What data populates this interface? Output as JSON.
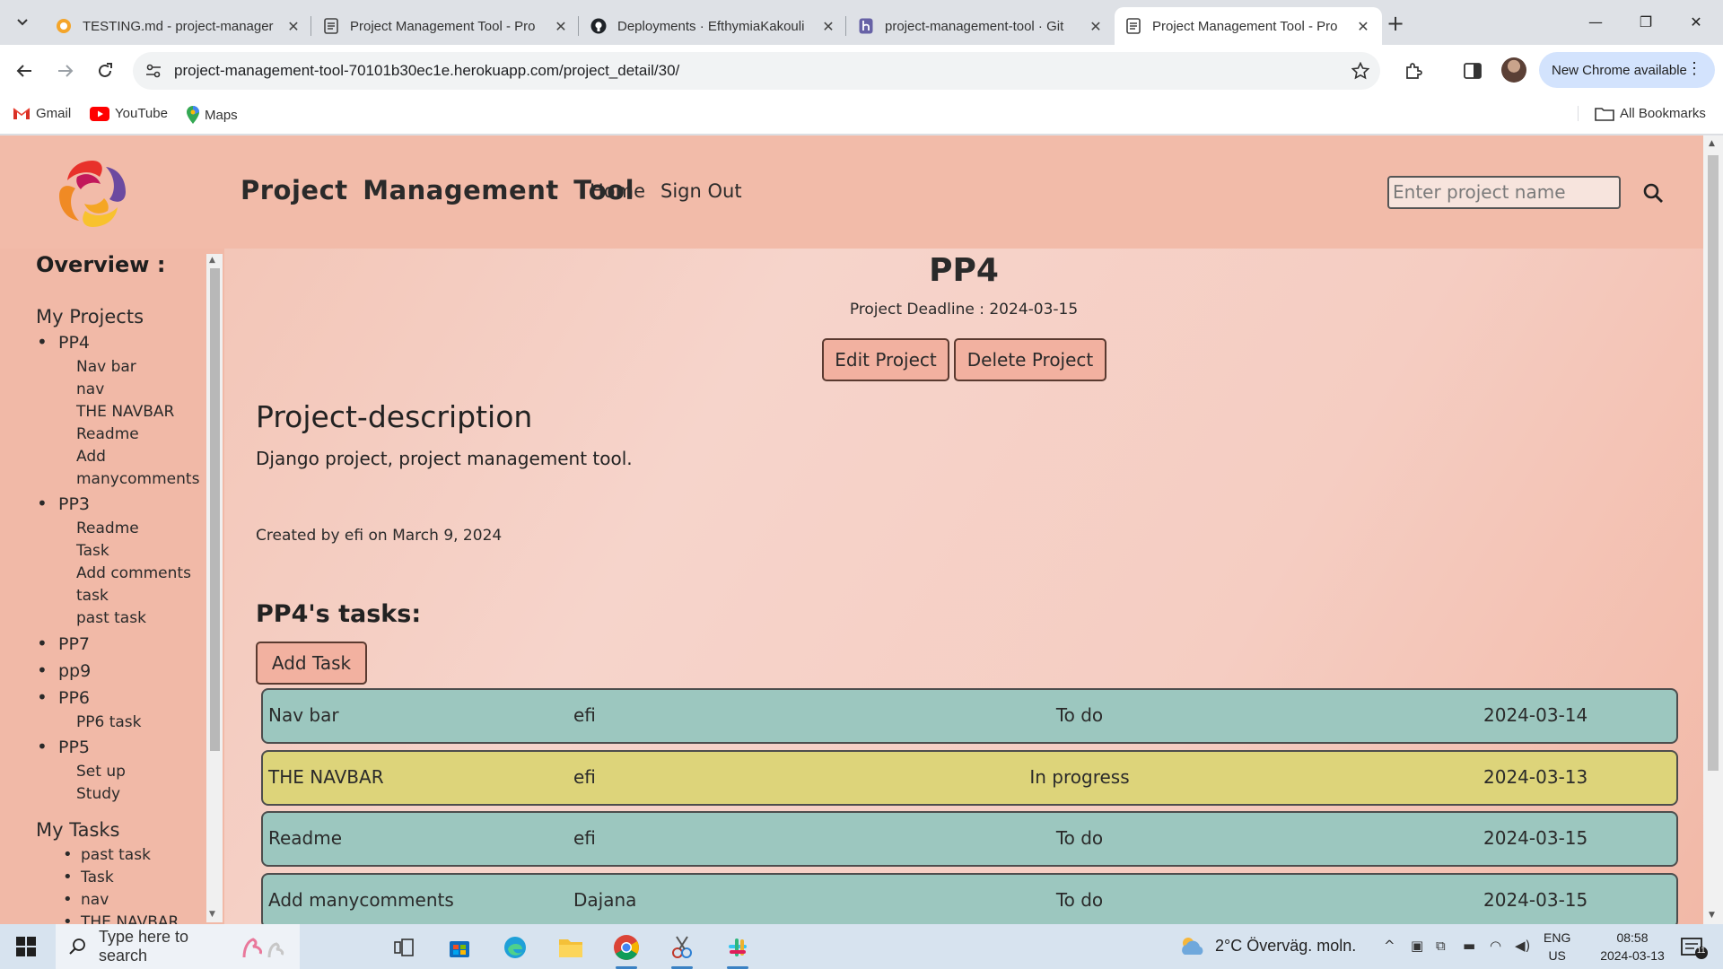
{
  "browser": {
    "tabs": [
      {
        "title": "TESTING.md - project-manager",
        "icon": "google-docs-icon",
        "active": false
      },
      {
        "title": "Project Management Tool - Pro",
        "icon": "page-icon",
        "active": false
      },
      {
        "title": "Deployments · EfthymiaKakouli",
        "icon": "github-icon",
        "active": false
      },
      {
        "title": "project-management-tool · Git",
        "icon": "heroku-icon",
        "active": false
      },
      {
        "title": "Project Management Tool - Pro",
        "icon": "page-icon",
        "active": true
      }
    ],
    "url": "project-management-tool-70101b30ec1e.herokuapp.com/project_detail/30/",
    "update_label": "New Chrome available",
    "bookmarks": [
      {
        "label": "Gmail",
        "icon": "gmail-icon"
      },
      {
        "label": "YouTube",
        "icon": "youtube-icon"
      },
      {
        "label": "Maps",
        "icon": "maps-icon"
      }
    ],
    "all_bookmarks": "All Bookmarks"
  },
  "site": {
    "brand": "Project Management Tool",
    "nav": {
      "home": "Home",
      "signout": "Sign Out"
    },
    "search_placeholder": "Enter project name"
  },
  "sidebar": {
    "overview_title": "Overview :",
    "my_projects_title": "My Projects",
    "projects": [
      {
        "name": "PP4",
        "tasks": [
          "Nav bar",
          "nav",
          "THE NAVBAR",
          "Readme",
          "Add",
          "manycomments"
        ]
      },
      {
        "name": "PP3",
        "tasks": [
          "Readme",
          "Task",
          "Add comments",
          "task",
          "past task"
        ]
      },
      {
        "name": "PP7",
        "tasks": []
      },
      {
        "name": "pp9",
        "tasks": []
      },
      {
        "name": "PP6",
        "tasks": [
          "PP6 task"
        ]
      },
      {
        "name": "PP5",
        "tasks": [
          "Set up",
          "Study"
        ]
      }
    ],
    "my_tasks_title": "My Tasks",
    "my_tasks": [
      "past task",
      "Task",
      "nav",
      "THE NAVBAR"
    ]
  },
  "project": {
    "name": "PP4",
    "deadline": "Project Deadline : 2024-03-15",
    "edit_label": "Edit Project",
    "delete_label": "Delete Project",
    "description_title": "Project-description",
    "description": "Django project, project management tool.",
    "created": "Created by efi on March 9, 2024",
    "tasks_title": "PP4's tasks:",
    "add_task_label": "Add Task",
    "tasks": [
      {
        "name": "Nav bar",
        "user": "efi",
        "status": "To do",
        "date": "2024-03-14"
      },
      {
        "name": "THE NAVBAR",
        "user": "efi",
        "status": "In progress",
        "date": "2024-03-13"
      },
      {
        "name": "Readme",
        "user": "efi",
        "status": "To do",
        "date": "2024-03-15"
      },
      {
        "name": "Add manycomments",
        "user": "Dajana",
        "status": "To do",
        "date": "2024-03-15"
      }
    ]
  },
  "colors": {
    "header_bg": "#f2bba9",
    "task_todo": "#9cc7bf",
    "task_in_progress": "#ddd47a",
    "button_bg": "#f2b1a0"
  },
  "taskbar": {
    "search_placeholder": "Type here to search",
    "weather": "2°C  Överväg. moln.",
    "lang_top": "ENG",
    "lang_bottom": "US",
    "time": "08:58",
    "date": "2024-03-13",
    "notifications": "11"
  }
}
